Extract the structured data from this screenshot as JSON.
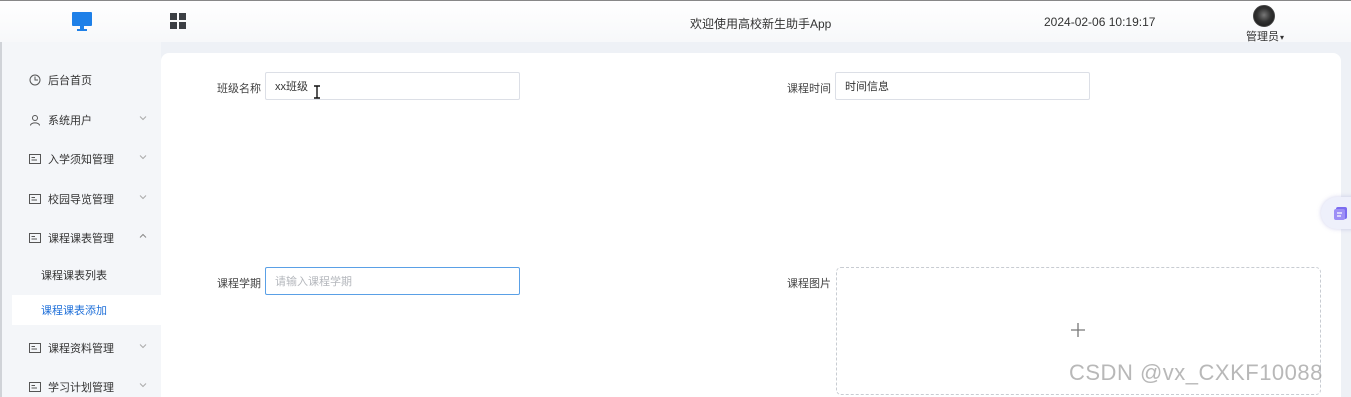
{
  "header": {
    "welcome": "欢迎使用高校新生助手App",
    "datetime": "2024-02-06 10:19:17",
    "user_menu": "管理员",
    "icons": [
      "monitor-logo-icon",
      "grid-icon",
      "avatar"
    ]
  },
  "sidebar": {
    "items": [
      {
        "label": "后台首页",
        "icon": "clock-icon"
      },
      {
        "label": "系统用户",
        "icon": "user-icon",
        "arrow": "down"
      },
      {
        "label": "入学须知管理",
        "icon": "card-icon",
        "arrow": "down"
      },
      {
        "label": "校园导览管理",
        "icon": "card-icon",
        "arrow": "down"
      },
      {
        "label": "课程课表管理",
        "icon": "card-icon",
        "arrow": "up"
      },
      {
        "label": "课程资料管理",
        "icon": "card-icon",
        "arrow": "down"
      },
      {
        "label": "学习计划管理",
        "icon": "card-icon",
        "arrow": "down"
      }
    ],
    "sub_items": [
      {
        "label": "课程课表列表",
        "active": false
      },
      {
        "label": "课程课表添加",
        "active": true
      }
    ],
    "active_color": "#1e6fd9"
  },
  "form": {
    "class_name": {
      "label": "班级名称",
      "value": "xx班级"
    },
    "course_time": {
      "label": "课程时间",
      "value": "时间信息"
    },
    "course_term": {
      "label": "课程学期",
      "placeholder": "请输入课程学期"
    },
    "course_image": {
      "label": "课程图片",
      "upload_icon": "plus-icon"
    }
  },
  "watermark": "CSDN @vx_CXKF10088"
}
